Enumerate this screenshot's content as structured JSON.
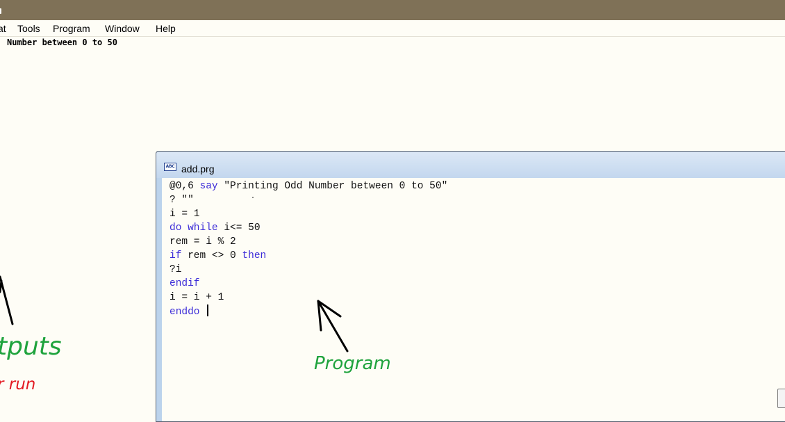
{
  "menu": {
    "items": [
      {
        "label": "at"
      },
      {
        "label": "Tools"
      },
      {
        "label": "Program"
      },
      {
        "label": "Window"
      },
      {
        "label": "Help"
      }
    ]
  },
  "screen_output": {
    "text": "Number between 0 to 50"
  },
  "editor": {
    "title": "add.prg",
    "doc_icon_text": "ABC",
    "lines": [
      {
        "kw": "",
        "rest": "@0,6 ",
        "kw2": "say",
        "rest2": " \"Printing Odd Number between 0 to 50\""
      },
      {
        "kw": "",
        "rest": "? \"\"",
        "kw2": "",
        "rest2": ""
      },
      {
        "kw": "",
        "rest": "i = 1",
        "kw2": "",
        "rest2": ""
      },
      {
        "kw": "do while",
        "rest": " i<= 50",
        "kw2": "",
        "rest2": ""
      },
      {
        "kw": "",
        "rest": "rem = i % 2",
        "kw2": "",
        "rest2": ""
      },
      {
        "kw": "if",
        "rest": " rem <> 0 ",
        "kw2": "then",
        "rest2": ""
      },
      {
        "kw": "",
        "rest": "?i",
        "kw2": "",
        "rest2": ""
      },
      {
        "kw": "endif",
        "rest": "",
        "kw2": "",
        "rest2": ""
      },
      {
        "kw": "",
        "rest": "i = i + 1",
        "kw2": "",
        "rest2": ""
      },
      {
        "kw": "enddo",
        "rest": " ",
        "kw2": "",
        "rest2": ""
      }
    ]
  },
  "annotations": {
    "outputs": "tputs",
    "run": "r run",
    "program": "Program",
    "green": "#1fa33d",
    "red": "#e31b23"
  },
  "colors": {
    "titlebar": "#7f7157",
    "keyword": "#3b2bd8",
    "background": "#fefdf6"
  }
}
